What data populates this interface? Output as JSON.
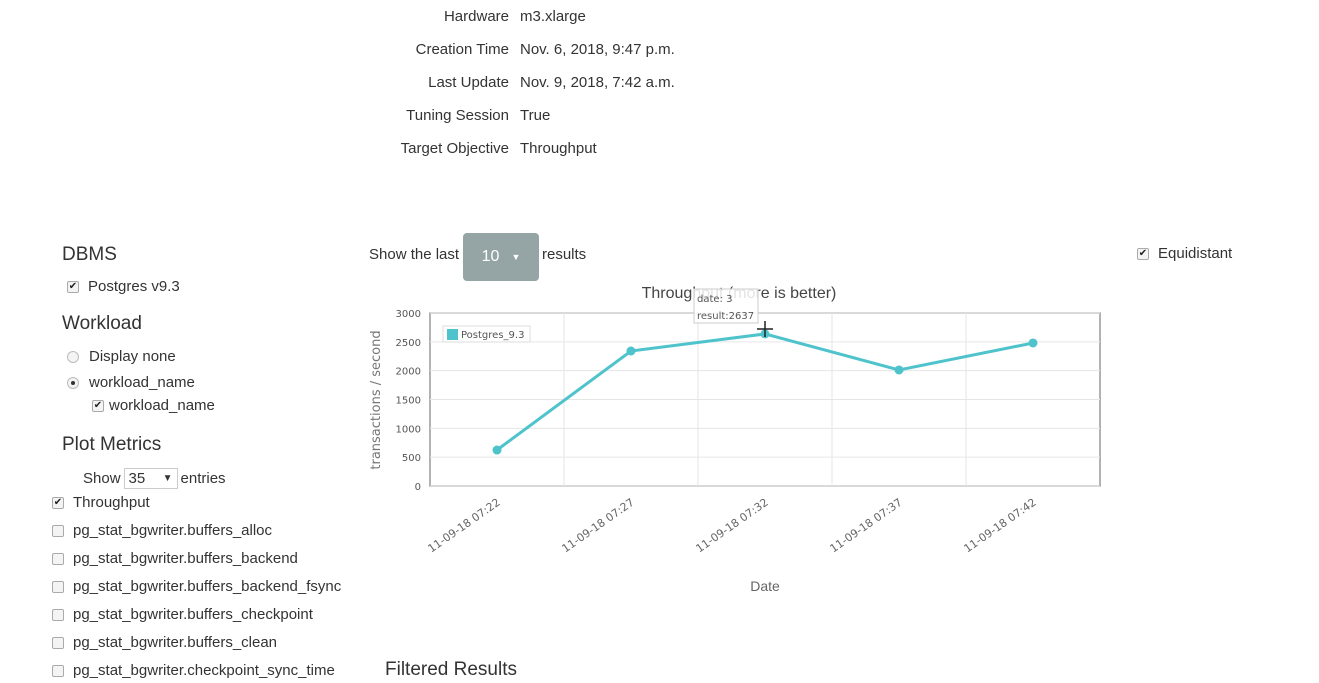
{
  "info": [
    {
      "label": "Hardware",
      "value": "m3.xlarge"
    },
    {
      "label": "Creation Time",
      "value": "Nov. 6, 2018, 9:47 p.m."
    },
    {
      "label": "Last Update",
      "value": "Nov. 9, 2018, 7:42 a.m."
    },
    {
      "label": "Tuning Session",
      "value": "True"
    },
    {
      "label": "Target Objective",
      "value": "Throughput"
    }
  ],
  "sidebar": {
    "dbms_title": "DBMS",
    "dbms_items": [
      {
        "label": "Postgres v9.3",
        "checked": true
      }
    ],
    "workload_title": "Workload",
    "workload_options": [
      {
        "label": "Display none",
        "selected": false
      },
      {
        "label": "workload_name",
        "selected": true
      }
    ],
    "workload_sub": {
      "label": "workload_name",
      "checked": true
    },
    "metrics_title": "Plot Metrics",
    "show_label": "Show",
    "show_value": "35",
    "entries_label": "entries",
    "metrics": [
      {
        "label": "Throughput",
        "checked": true
      },
      {
        "label": "pg_stat_bgwriter.buffers_alloc",
        "checked": false
      },
      {
        "label": "pg_stat_bgwriter.buffers_backend",
        "checked": false
      },
      {
        "label": "pg_stat_bgwriter.buffers_backend_fsync",
        "checked": false
      },
      {
        "label": "pg_stat_bgwriter.buffers_checkpoint",
        "checked": false
      },
      {
        "label": "pg_stat_bgwriter.buffers_clean",
        "checked": false
      },
      {
        "label": "pg_stat_bgwriter.checkpoint_sync_time",
        "checked": false
      }
    ]
  },
  "controls": {
    "show_last": "Show the last",
    "count": "10",
    "results": "results",
    "equidistant": "Equidistant",
    "equidistant_checked": true
  },
  "filtered_title": "Filtered Results",
  "chart_data": {
    "type": "line",
    "title": "Throughput (more is better)",
    "xlabel": "Date",
    "ylabel": "transactions / second",
    "categories": [
      "11-09-18 07:22",
      "11-09-18 07:27",
      "11-09-18 07:32",
      "11-09-18 07:37",
      "11-09-18 07:42"
    ],
    "series": [
      {
        "name": "Postgres_9.3",
        "values": [
          624,
          2341,
          2637,
          2012,
          2480
        ],
        "color": "#4fc3cc"
      }
    ],
    "ylim": [
      0,
      3000
    ],
    "yticks": [
      0,
      500,
      1000,
      1500,
      2000,
      2500,
      3000
    ],
    "grid": true,
    "legend": "top-left",
    "tooltip": {
      "date": "date: 3",
      "result": "result:2637"
    }
  }
}
